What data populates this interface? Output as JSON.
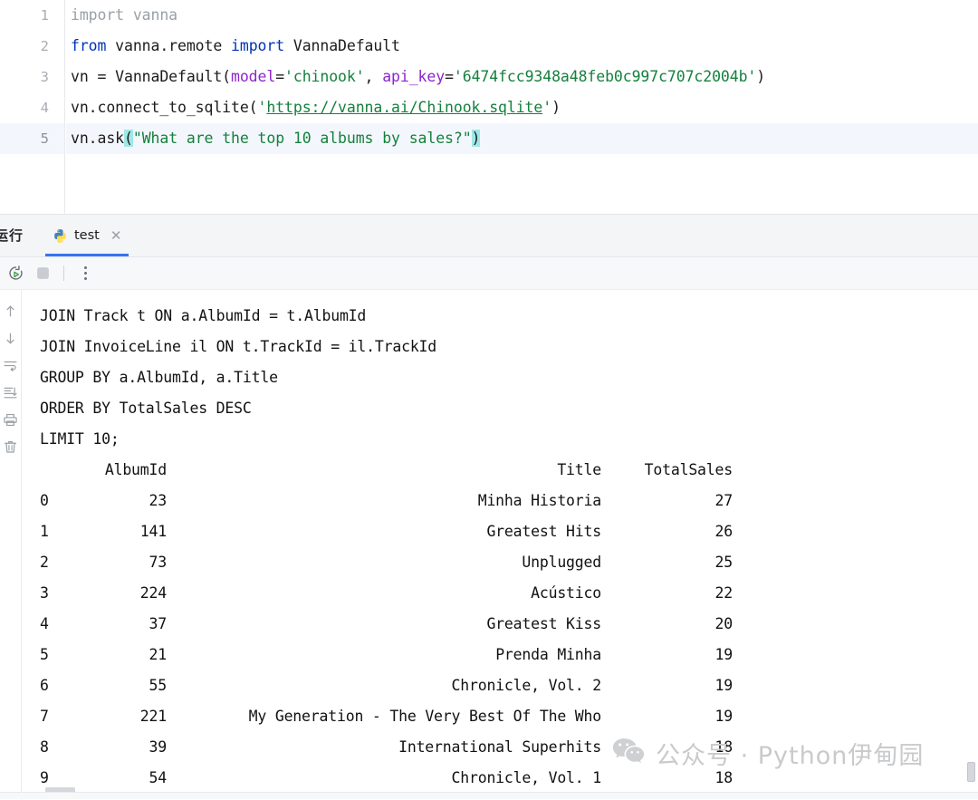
{
  "editor": {
    "lines": [
      {
        "num": "1",
        "tokens": [
          {
            "t": "import vanna",
            "c": "tok-dim"
          }
        ]
      },
      {
        "num": "2",
        "tokens": [
          {
            "t": "from",
            "c": "tok-kw"
          },
          {
            "t": " vanna.remote ",
            "c": ""
          },
          {
            "t": "import",
            "c": "tok-kw"
          },
          {
            "t": " VannaDefault",
            "c": ""
          }
        ]
      },
      {
        "num": "3",
        "tokens": [
          {
            "t": "vn = VannaDefault(",
            "c": ""
          },
          {
            "t": "model",
            "c": "tok-named"
          },
          {
            "t": "=",
            "c": ""
          },
          {
            "t": "'chinook'",
            "c": "tok-str"
          },
          {
            "t": ", ",
            "c": ""
          },
          {
            "t": "api_key",
            "c": "tok-named"
          },
          {
            "t": "=",
            "c": ""
          },
          {
            "t": "'6474fcc9348a48feb0c997c707c2004b'",
            "c": "tok-str"
          },
          {
            "t": ")",
            "c": ""
          }
        ]
      },
      {
        "num": "4",
        "tokens": [
          {
            "t": "vn.connect_to_sqlite(",
            "c": ""
          },
          {
            "t": "'",
            "c": "tok-str"
          },
          {
            "t": "https://vanna.ai/Chinook.sqlite",
            "c": "tok-url"
          },
          {
            "t": "'",
            "c": "tok-str"
          },
          {
            "t": ")",
            "c": ""
          }
        ]
      },
      {
        "num": "5",
        "highlighted": true,
        "tokens": [
          {
            "t": "vn.ask",
            "c": ""
          },
          {
            "t": "(",
            "c": "tok-brace"
          },
          {
            "t": "\"What are the top 10 albums by sales?\"",
            "c": "tok-str"
          },
          {
            "t": ")",
            "c": "tok-brace"
          }
        ]
      }
    ]
  },
  "run_panel": {
    "label": "运行",
    "tab": {
      "name": "test",
      "icon": "python-icon",
      "close": "✕"
    },
    "toolbar": {
      "rerun": "rerun-icon",
      "stop": "stop-icon",
      "more": "more-options-icon"
    },
    "gutter_icons": [
      "scroll-up-icon",
      "scroll-down-icon",
      "soft-wrap-icon",
      "scroll-to-end-icon",
      "print-icon",
      "clear-all-icon"
    ]
  },
  "console": {
    "sql_lines": [
      "JOIN Track t ON a.AlbumId = t.AlbumId",
      "JOIN InvoiceLine il ON t.TrackId = il.TrackId",
      "GROUP BY a.AlbumId, a.Title",
      "ORDER BY TotalSales DESC",
      "LIMIT 10;"
    ],
    "table": {
      "columns": [
        "",
        "AlbumId",
        "Title",
        "TotalSales"
      ],
      "rows": [
        {
          "idx": "0",
          "album_id": "23",
          "title": "Minha Historia",
          "total_sales": "27"
        },
        {
          "idx": "1",
          "album_id": "141",
          "title": "Greatest Hits",
          "total_sales": "26"
        },
        {
          "idx": "2",
          "album_id": "73",
          "title": "Unplugged",
          "total_sales": "25"
        },
        {
          "idx": "3",
          "album_id": "224",
          "title": "Acústico",
          "total_sales": "22"
        },
        {
          "idx": "4",
          "album_id": "37",
          "title": "Greatest Kiss",
          "total_sales": "20"
        },
        {
          "idx": "5",
          "album_id": "21",
          "title": "Prenda Minha",
          "total_sales": "19"
        },
        {
          "idx": "6",
          "album_id": "55",
          "title": "Chronicle, Vol. 2",
          "total_sales": "19"
        },
        {
          "idx": "7",
          "album_id": "221",
          "title": "My Generation - The Very Best Of The Who",
          "total_sales": "19"
        },
        {
          "idx": "8",
          "album_id": "39",
          "title": "International Superhits",
          "total_sales": "18"
        },
        {
          "idx": "9",
          "album_id": "54",
          "title": "Chronicle, Vol. 1",
          "total_sales": "18"
        }
      ]
    }
  },
  "watermark": {
    "icon": "wechat-icon",
    "text": "公众号 · Python伊甸园"
  },
  "colors": {
    "accent": "#3574f0",
    "string": "#15803d",
    "keyword": "#0033b3",
    "named_arg": "#8c26c9",
    "brace_match": "#9fe8e6",
    "line_highlight": "#f3f7fd"
  }
}
